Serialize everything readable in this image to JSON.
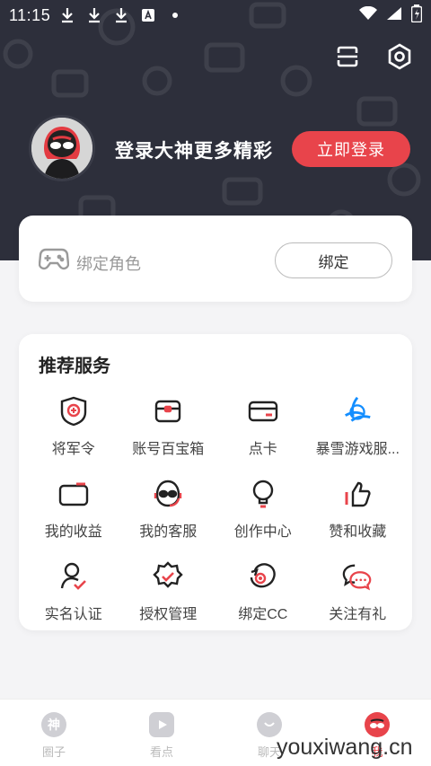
{
  "status_bar": {
    "time": "11:15"
  },
  "header": {
    "login_prompt": "登录大神更多精彩",
    "login_button": "立即登录",
    "background_color": "#2d2f3b",
    "accent_color": "#e8444b"
  },
  "bind_card": {
    "label": "绑定角色",
    "button": "绑定"
  },
  "services": {
    "title": "推荐服务",
    "items": [
      {
        "label": "将军令",
        "icon": "shield-token-icon"
      },
      {
        "label": "账号百宝箱",
        "icon": "treasure-box-icon"
      },
      {
        "label": "点卡",
        "icon": "card-icon"
      },
      {
        "label": "暴雪游戏服...",
        "icon": "battlenet-icon"
      },
      {
        "label": "我的收益",
        "icon": "wallet-icon"
      },
      {
        "label": "我的客服",
        "icon": "headset-icon"
      },
      {
        "label": "创作中心",
        "icon": "lightbulb-icon"
      },
      {
        "label": "赞和收藏",
        "icon": "thumbs-up-icon"
      },
      {
        "label": "实名认证",
        "icon": "person-check-icon"
      },
      {
        "label": "授权管理",
        "icon": "badge-check-icon"
      },
      {
        "label": "绑定CC",
        "icon": "cc-bird-icon"
      },
      {
        "label": "关注有礼",
        "icon": "chat-bubbles-icon"
      }
    ]
  },
  "tabbar": {
    "tabs": [
      {
        "label": "圈子",
        "icon": "circle-shen-icon"
      },
      {
        "label": "看点",
        "icon": "video-icon"
      },
      {
        "label": "聊天",
        "icon": "chat-icon"
      },
      {
        "label": "我",
        "icon": "profile-mask-icon"
      }
    ]
  },
  "watermark": "youxiwang.cn"
}
